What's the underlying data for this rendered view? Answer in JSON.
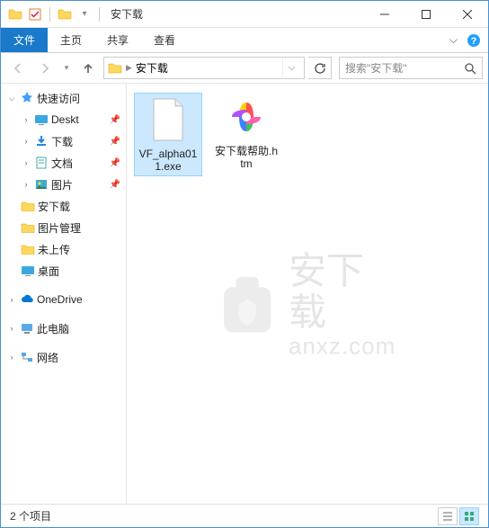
{
  "titlebar": {
    "title": "安下载"
  },
  "ribbon": {
    "file": "文件",
    "home": "主页",
    "share": "共享",
    "view": "查看"
  },
  "breadcrumb": {
    "current": "安下载"
  },
  "search": {
    "placeholder": "搜索\"安下载\""
  },
  "sidebar": {
    "quick_access": "快速访问",
    "items": [
      {
        "label": "Deskt"
      },
      {
        "label": "下载"
      },
      {
        "label": "文档"
      },
      {
        "label": "图片"
      },
      {
        "label": "安下载"
      },
      {
        "label": "图片管理"
      },
      {
        "label": "未上传"
      },
      {
        "label": "桌面"
      }
    ],
    "onedrive": "OneDrive",
    "this_pc": "此电脑",
    "network": "网络"
  },
  "files": [
    {
      "name": "VF_alpha011.exe"
    },
    {
      "name": "安下载帮助.htm"
    }
  ],
  "statusbar": {
    "count": "2 个项目"
  },
  "watermark": {
    "cn": "安下载",
    "url": "anxz.com"
  }
}
